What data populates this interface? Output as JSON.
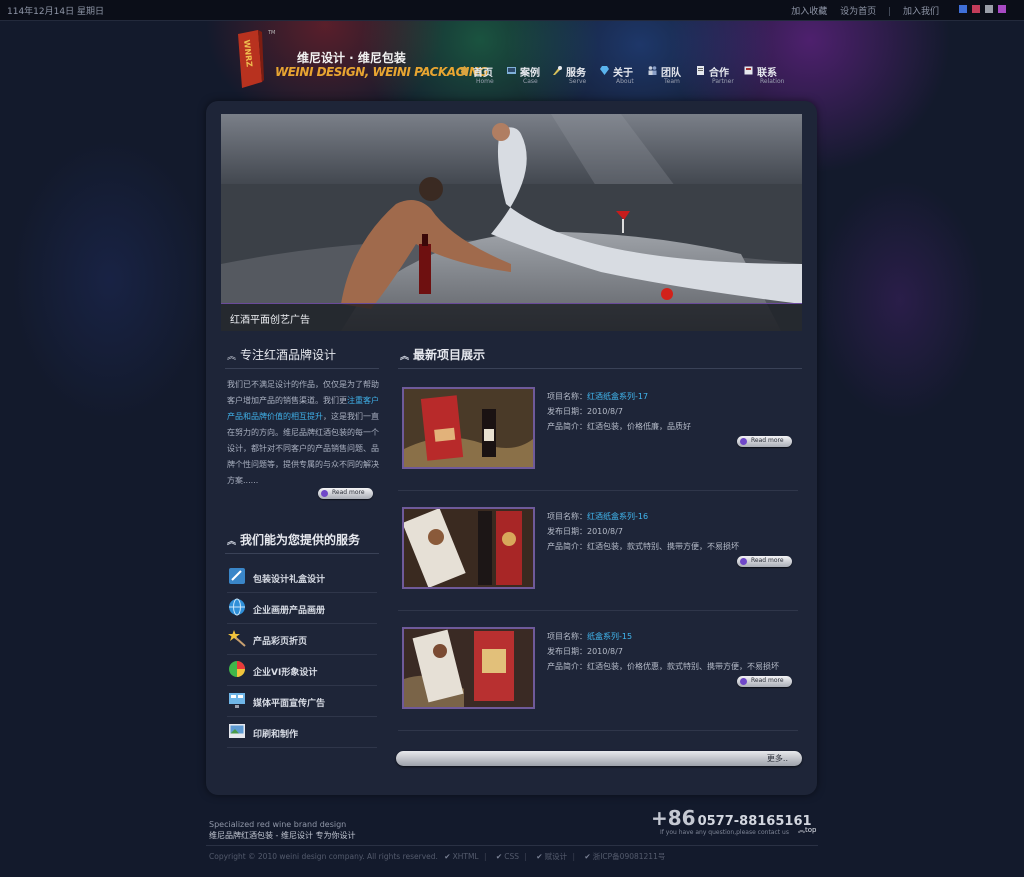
{
  "topbar": {
    "date": "114年12月14日 星期日",
    "links": [
      "加入收藏",
      "设为首页",
      "加入我们"
    ],
    "swatches": [
      "#3f6fd8",
      "#c33c5a",
      "#9a9ea8",
      "#a84ac4"
    ]
  },
  "logo": {
    "mark": "WNRZ",
    "tm": "TM",
    "cn": "维尼设计 · 维尼包装",
    "en": "WEINI DESIGN, WEINI PACKAGING"
  },
  "nav": [
    {
      "cn": "首页",
      "en": "Home",
      "icon": "home-icon",
      "color": "#d9a441"
    },
    {
      "cn": "案例",
      "en": "Case",
      "icon": "gallery-icon",
      "color": "#7fb0d8"
    },
    {
      "cn": "服务",
      "en": "Serve",
      "icon": "tools-icon",
      "color": "#d8c15a"
    },
    {
      "cn": "关于",
      "en": "About",
      "icon": "diamond-icon",
      "color": "#5ab4ee"
    },
    {
      "cn": "团队",
      "en": "Team",
      "icon": "team-icon",
      "color": "#c9d0dc"
    },
    {
      "cn": "合作",
      "en": "Partner",
      "icon": "document-icon",
      "color": "#e6e8ee"
    },
    {
      "cn": "联系",
      "en": "Relation",
      "icon": "contact-icon",
      "color": "#e6e8ee"
    }
  ],
  "hero": {
    "caption": "红酒平面创艺广告"
  },
  "intro": {
    "title": "专注红酒品牌设计",
    "text_a": "我们已不满足设计的作品，仅仅是为了帮助客户增加产品的销售渠道。我们更",
    "highlight": "注重客户产品和品牌价值的相互提升",
    "text_b": "，这是我们一直在努力的方向。维尼品牌红酒包装的每一个设计，都针对不同客户的产品销售问题、品牌个性问题等，提供专属的与众不同的解决方案......",
    "read_more": "Read more"
  },
  "services": {
    "title": "我们能为您提供的服务",
    "items": [
      {
        "label": "包装设计礼盒设计",
        "icon": "package-design-icon"
      },
      {
        "label": "企业画册产品画册",
        "icon": "globe-icon"
      },
      {
        "label": "产品彩页折页",
        "icon": "magic-wand-icon"
      },
      {
        "label": "企业VI形象设计",
        "icon": "pie-chart-icon"
      },
      {
        "label": "媒体平面宣传广告",
        "icon": "monitor-icon"
      },
      {
        "label": "印刷和制作",
        "icon": "picture-icon"
      }
    ]
  },
  "projects": {
    "title": "最新项目展示",
    "name_label": "项目名称：",
    "date_label": "发布日期：",
    "desc_label": "产品简介：",
    "read_more": "Read more",
    "items": [
      {
        "name": "红酒纸盒系列-17",
        "date": "2010/8/7",
        "desc": "红酒包装，价格低廉，品质好"
      },
      {
        "name": "红酒纸盒系列-16",
        "date": "2010/8/7",
        "desc": "红酒包装，款式特别、携带方便，不易损坏"
      },
      {
        "name": "纸盒系列-15",
        "date": "2010/8/7",
        "desc": "红酒包装，价格优惠，款式特别、携带方便，不易损坏"
      }
    ],
    "more": "更多.."
  },
  "footer": {
    "en": "Specialized red wine brand design",
    "cn": "维尼品牌红酒包装 - 维尼设计 专为你设计",
    "phone_cc": "+86",
    "phone_num": "0577-88165161",
    "phone_sub": "If you have any question,please contact us",
    "top": "top",
    "copyright": "Copyright © 2010 weini design company. All rights reserved.",
    "badges": [
      "XHTML",
      "CSS",
      "赋设计",
      "浙ICP备09081211号"
    ]
  }
}
